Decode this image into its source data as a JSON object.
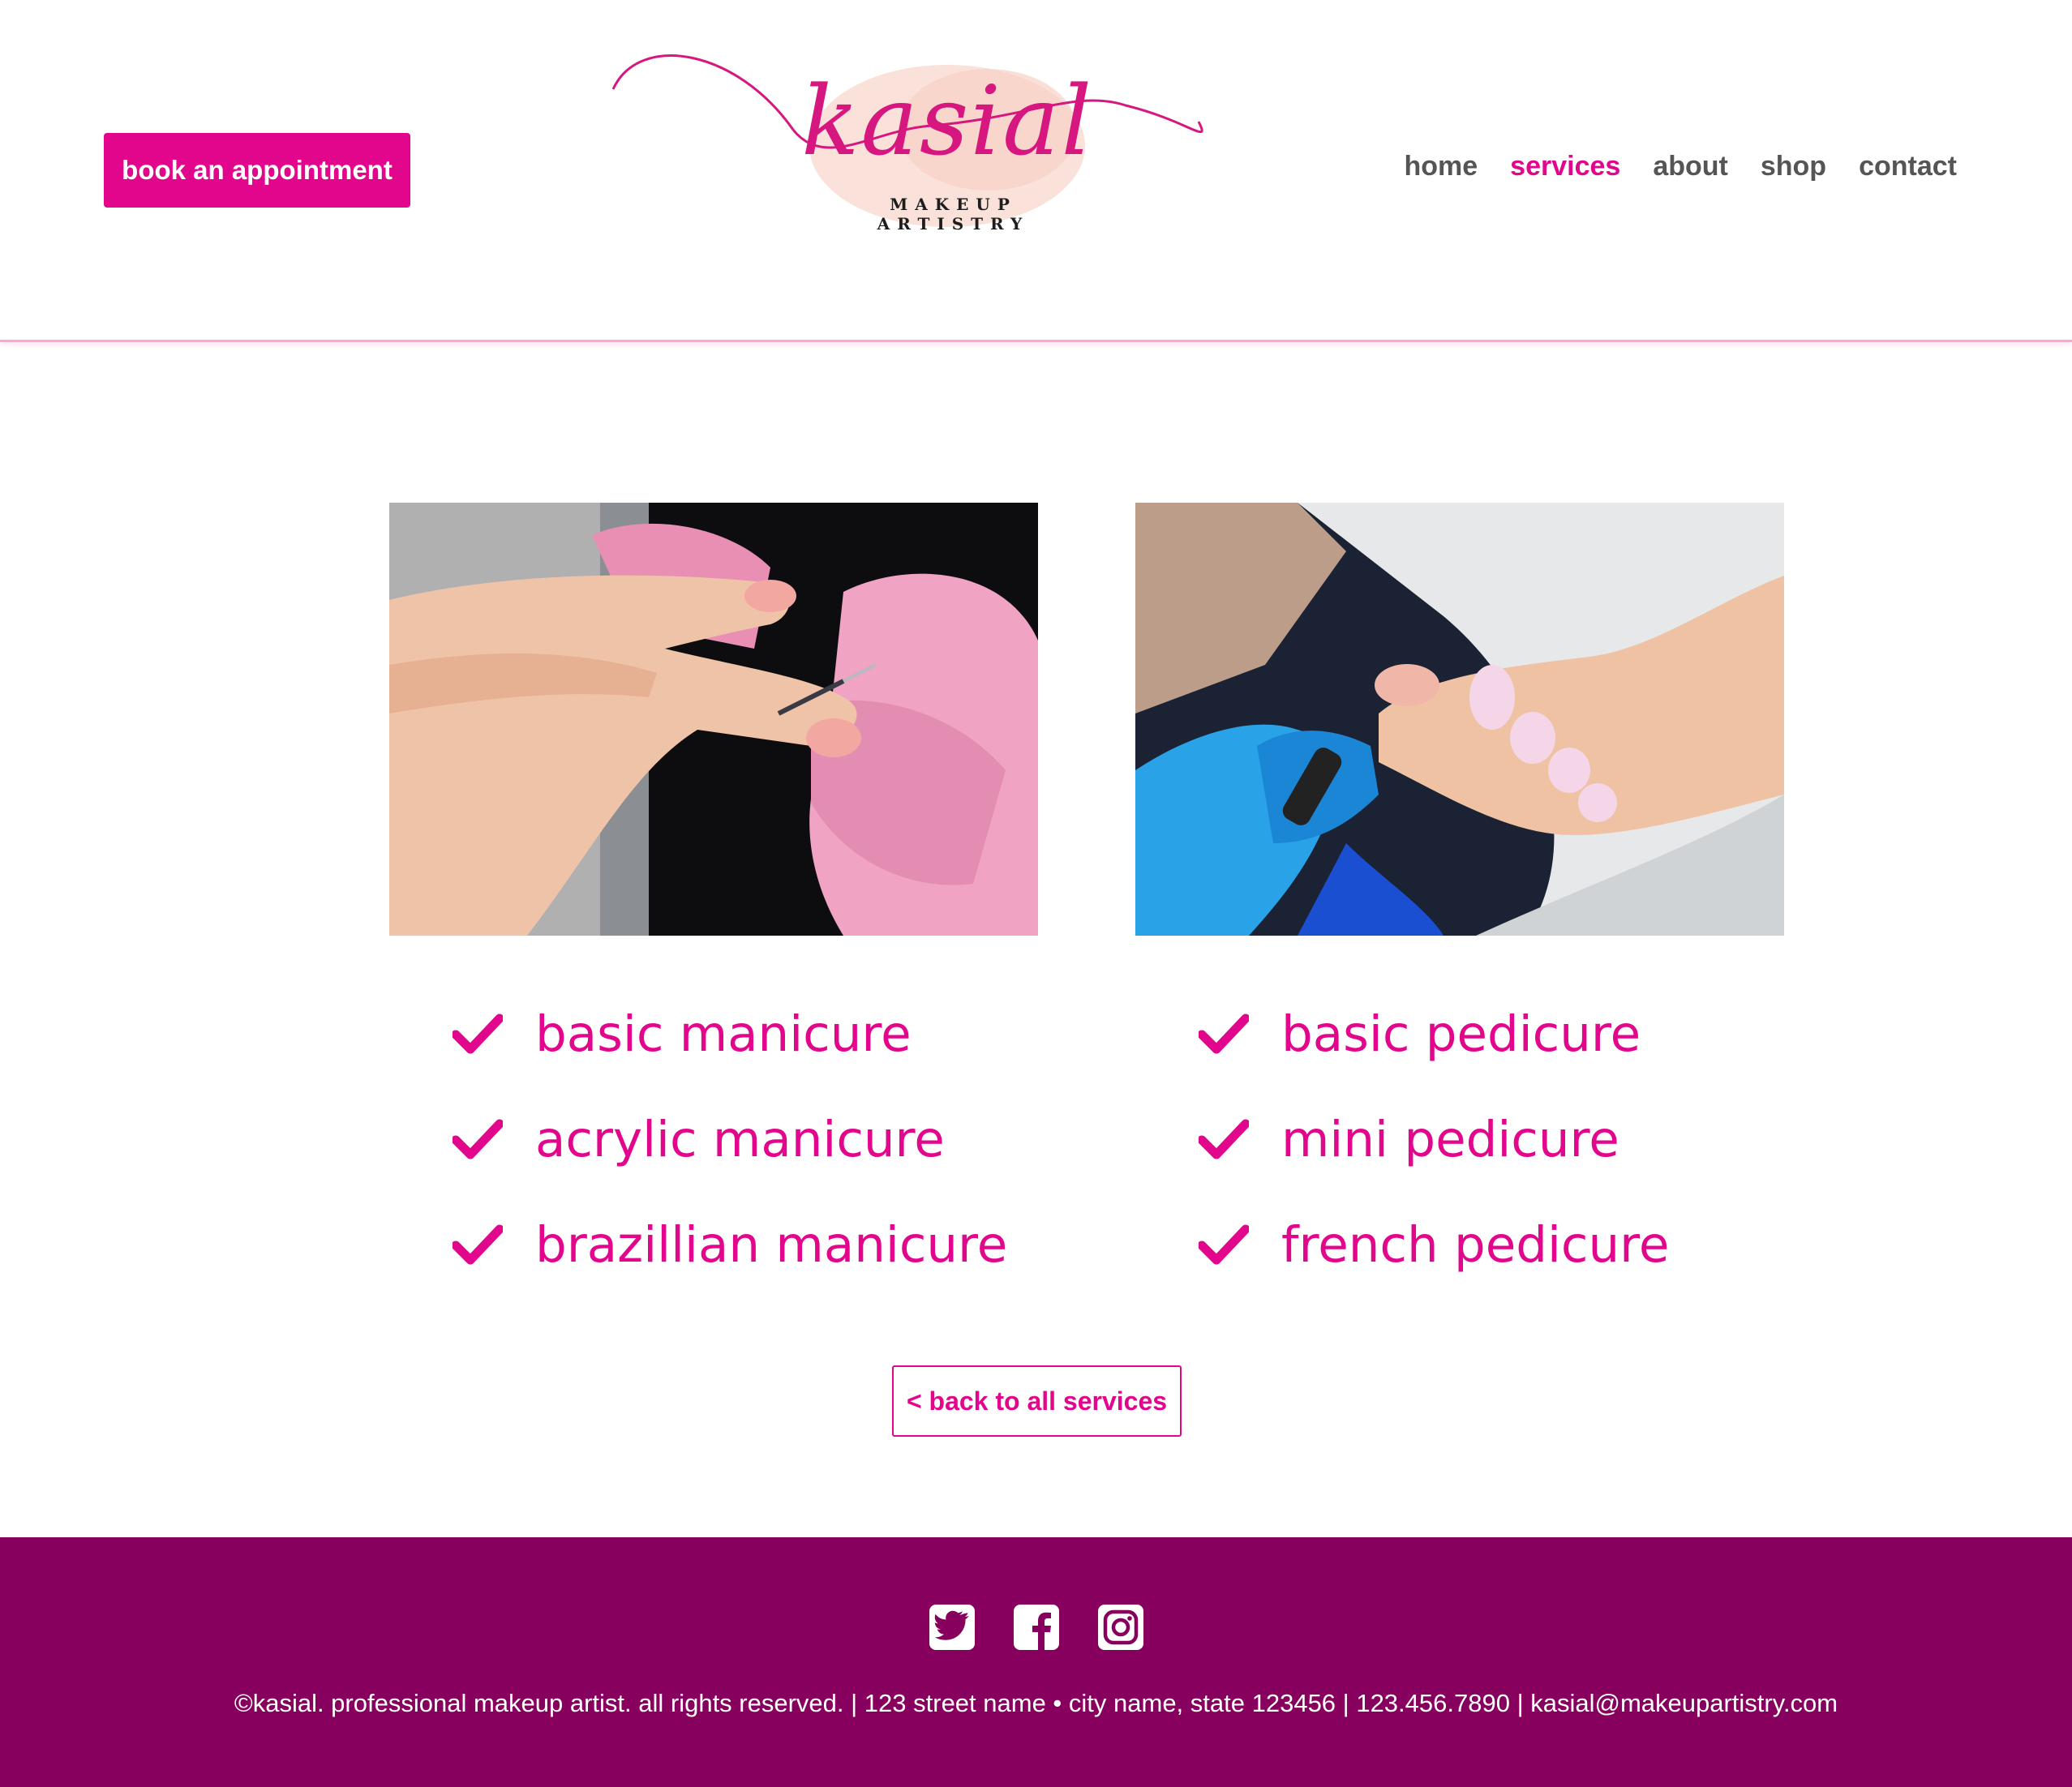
{
  "header": {
    "book_button_label": "book an appointment",
    "logo": {
      "wordmark": "kasial",
      "tagline": "MAKEUP ARTISTRY"
    },
    "nav": [
      {
        "label": "home",
        "active": false
      },
      {
        "label": "services",
        "active": true
      },
      {
        "label": "about",
        "active": false
      },
      {
        "label": "shop",
        "active": false
      },
      {
        "label": "contact",
        "active": false
      }
    ]
  },
  "main": {
    "manicure": {
      "photo_icon": "manicure-photo",
      "services": [
        "basic manicure",
        "acrylic manicure",
        "brazillian manicure"
      ]
    },
    "pedicure": {
      "photo_icon": "pedicure-photo",
      "services": [
        "basic pedicure",
        "mini pedicure",
        "french pedicure"
      ]
    },
    "back_button_label": "< back to all services"
  },
  "footer": {
    "social_icons": [
      "twitter-icon",
      "facebook-icon",
      "instagram-icon"
    ],
    "text": "©kasial. professional makeup artist. all rights reserved. | 123 street name • city name, state 123456 | 123.456.7890 | kasial@makeupartistry.com"
  },
  "colors": {
    "accent": "#e1068c",
    "footer_bg": "#87005e",
    "nav_text": "#555555",
    "header_rule": "#f7a9d4"
  }
}
